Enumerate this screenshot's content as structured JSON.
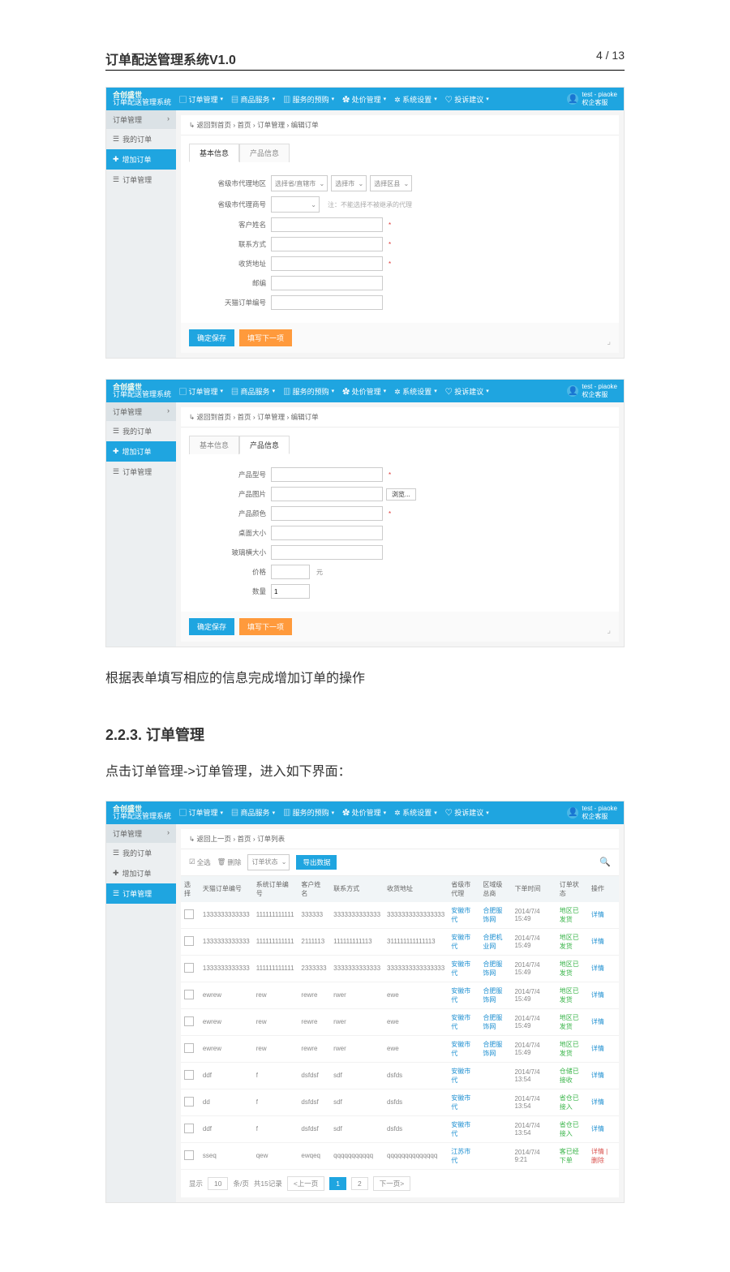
{
  "doc": {
    "title": "订单配送管理系统V1.0",
    "page": "4 / 13"
  },
  "brand": {
    "line1": "合创盛世",
    "line2": "订单配送管理系统"
  },
  "nav": [
    {
      "icon": "▢",
      "label": "订单管理"
    },
    {
      "icon": "▤",
      "label": "商品服务"
    },
    {
      "icon": "▥",
      "label": "服务的预购"
    },
    {
      "icon": "✿",
      "label": "处价管理"
    },
    {
      "icon": "✲",
      "label": "系统设置"
    },
    {
      "icon": "♡",
      "label": "投诉建议"
    }
  ],
  "user": {
    "name": "test - piaoke",
    "sub": "权企客服"
  },
  "side_header": "订单管理",
  "side_items": [
    "我的订单",
    "增加订单",
    "订单管理"
  ],
  "crumb1": "↳ 返回到首页  › 首页  › 订单管理  › 编辑订单",
  "tabs": [
    "基本信息",
    "产品信息"
  ],
  "shot1_form": {
    "fields": [
      {
        "label": "省级市代理地区",
        "type": "selects",
        "opts": [
          "选择省/直辖市",
          "选择市",
          "选择区县"
        ]
      },
      {
        "label": "省级市代理商号",
        "type": "smalsel",
        "note": "注：不能选择不被继承的代理"
      },
      {
        "label": "客户姓名",
        "type": "text",
        "req": true
      },
      {
        "label": "联系方式",
        "type": "text",
        "req": true
      },
      {
        "label": "收货地址",
        "type": "text",
        "req": true
      },
      {
        "label": "邮编",
        "type": "text"
      },
      {
        "label": "天猫订单编号",
        "type": "text"
      }
    ],
    "save": "确定保存",
    "next": "填写下一项"
  },
  "shot2_form": {
    "fields": [
      {
        "label": "产品型号",
        "type": "text",
        "req": true
      },
      {
        "label": "产品图片",
        "type": "file",
        "btn": "浏览..."
      },
      {
        "label": "产品颜色",
        "type": "text",
        "req": true
      },
      {
        "label": "桌面大小",
        "type": "text"
      },
      {
        "label": "玻璃横大小",
        "type": "text"
      },
      {
        "label": "价格",
        "type": "small",
        "unit": "元"
      },
      {
        "label": "数量",
        "type": "small",
        "val": "1"
      }
    ],
    "save": "确定保存",
    "next": "填写下一项"
  },
  "text1": "根据表单填写相应的信息完成增加订单的操作",
  "heading": "2.2.3. 订单管理",
  "text2": "点击订单管理->订单管理，进入如下界面：",
  "crumb3": "↳ 返回上一页  › 首页  › 订单列表",
  "toolbar": {
    "all": "全选",
    "del": "删除",
    "status": "订单状态",
    "export": "导出数据"
  },
  "cols": [
    "选择",
    "天猫订单编号",
    "系统订单编号",
    "客户姓名",
    "联系方式",
    "收货地址",
    "省级市代理",
    "区域级总商",
    "下单时间",
    "订单状态",
    "操作"
  ],
  "rows": [
    {
      "a": "1333333333333",
      "b": "111111111111",
      "c": "333333",
      "d": "3333333333333",
      "e": "3333333333333333",
      "f": "安徽市代",
      "g": "合肥服饰网",
      "h": "2014/7/4 15:49",
      "i": "地区已发货",
      "j": "详情"
    },
    {
      "a": "1333333333333",
      "b": "111111111111",
      "c": "2111113",
      "d": "111111111113",
      "e": "311111111111113",
      "f": "安徽市代",
      "g": "合肥机业网",
      "h": "2014/7/4 15:49",
      "i": "地区已发货",
      "j": "详情"
    },
    {
      "a": "1333333333333",
      "b": "111111111111",
      "c": "2333333",
      "d": "3333333333333",
      "e": "3333333333333333",
      "f": "安徽市代",
      "g": "合肥服饰网",
      "h": "2014/7/4 15:49",
      "i": "地区已发货",
      "j": "详情"
    },
    {
      "a": "ewrew",
      "b": "rew",
      "c": "rewre",
      "d": "rwer",
      "e": "ewe",
      "f": "安徽市代",
      "g": "合肥服饰网",
      "h": "2014/7/4 15:49",
      "i": "地区已发货",
      "j": "详情"
    },
    {
      "a": "ewrew",
      "b": "rew",
      "c": "rewre",
      "d": "rwer",
      "e": "ewe",
      "f": "安徽市代",
      "g": "合肥服饰网",
      "h": "2014/7/4 15:49",
      "i": "地区已发货",
      "j": "详情"
    },
    {
      "a": "ewrew",
      "b": "rew",
      "c": "rewre",
      "d": "rwer",
      "e": "ewe",
      "f": "安徽市代",
      "g": "合肥服饰网",
      "h": "2014/7/4 15:49",
      "i": "地区已发货",
      "j": "详情"
    },
    {
      "a": "ddf",
      "b": "f",
      "c": "dsfdsf",
      "d": "sdf",
      "e": "dsfds",
      "f": "安徽市代",
      "g": "",
      "h": "2014/7/4 13:54",
      "i": "仓储已接收",
      "j": "详情"
    },
    {
      "a": "dd",
      "b": "f",
      "c": "dsfdsf",
      "d": "sdf",
      "e": "dsfds",
      "f": "安徽市代",
      "g": "",
      "h": "2014/7/4 13:54",
      "i": "省仓已接入",
      "j": "详情"
    },
    {
      "a": "ddf",
      "b": "f",
      "c": "dsfdsf",
      "d": "sdf",
      "e": "dsfds",
      "f": "安徽市代",
      "g": "",
      "h": "2014/7/4 13:54",
      "i": "省仓已接入",
      "j": "详情"
    },
    {
      "a": "sseq",
      "b": "qew",
      "c": "ewqeq",
      "d": "qqqqqqqqqqq",
      "e": "qqqqqqqqqqqqqq",
      "f": "江苏市代",
      "g": "",
      "h": "2014/7/4 9:21",
      "i": "客已经下单",
      "j": "详情 | 删除"
    }
  ],
  "pager": {
    "show": "显示",
    "per": "10",
    "unit": "条/页",
    "total": "共15记录",
    "prev": "<上一页",
    "p1": "1",
    "p2": "2",
    "next": "下一页>"
  }
}
